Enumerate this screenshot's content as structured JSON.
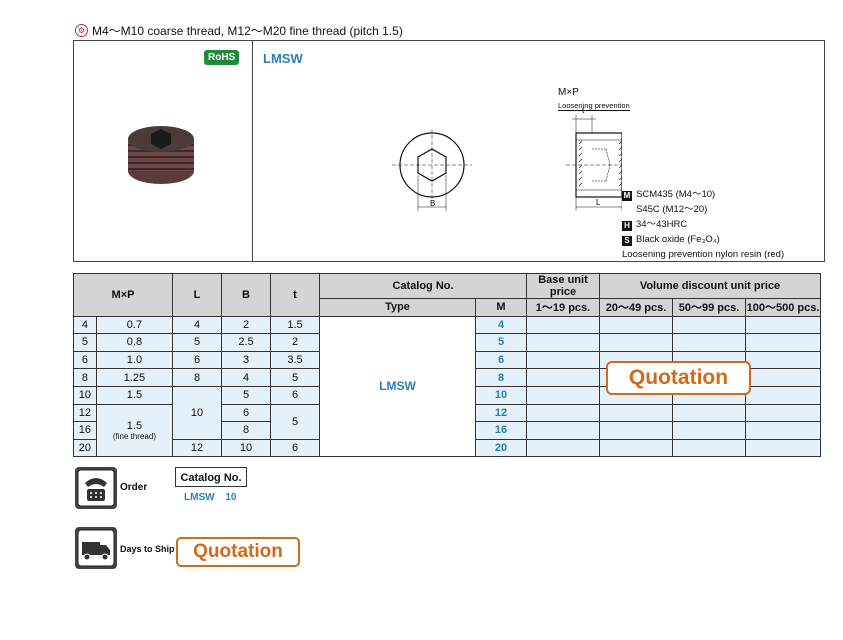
{
  "header": {
    "mark": "⚙",
    "text": "M4～M10 coarse thread, M12～M20 fine thread (pitch 1.5)"
  },
  "product": {
    "rohs": "RoHS",
    "title": "LMSW"
  },
  "drawing": {
    "mxp": "M×P",
    "loosening": "Loosening prevention",
    "t": "t",
    "b": "B",
    "l": "L"
  },
  "spec": [
    {
      "key": "M",
      "text": "SCM435 (M4～10)"
    },
    {
      "key": "",
      "text": "S45C (M12～20)"
    },
    {
      "key": "H",
      "text": "34～43HRC"
    },
    {
      "key": "S",
      "text": "Black oxide (Fe₃O₄)"
    },
    {
      "key": "",
      "text": "Loosening prevention nylon resin (red)"
    }
  ],
  "table": {
    "headers": {
      "mxp": "M×P",
      "l": "L",
      "b": "B",
      "t": "t",
      "catalog": "Catalog No.",
      "type": "Type",
      "m": "M",
      "base": "Base unit price",
      "base_sub": "1～19 pcs.",
      "volume": "Volume discount unit price",
      "v1": "20～49 pcs.",
      "v2": "50～99 pcs.",
      "v3": "100～500 pcs."
    },
    "type_value": "LMSW",
    "rows": [
      {
        "m": "4",
        "p": "0.7",
        "l": "4",
        "b": "2",
        "t": "1.5",
        "mm": "4"
      },
      {
        "m": "5",
        "p": "0.8",
        "l": "5",
        "b": "2.5",
        "t": "2",
        "mm": "5"
      },
      {
        "m": "6",
        "p": "1.0",
        "l": "6",
        "b": "3",
        "t": "3.5",
        "mm": "6"
      },
      {
        "m": "8",
        "p": "1.25",
        "l": "8",
        "b": "4",
        "t": "5",
        "mm": "8"
      },
      {
        "m": "10",
        "p": "1.5",
        "l": "",
        "b": "5",
        "t": "6",
        "mm": "10"
      },
      {
        "m": "12",
        "p": "",
        "l": "10",
        "b": "6",
        "t": "5",
        "mm": "12"
      },
      {
        "m": "16",
        "p": "",
        "l": "",
        "b": "8",
        "t": "",
        "mm": "16"
      },
      {
        "m": "20",
        "p": "",
        "l": "12",
        "b": "10",
        "t": "6",
        "mm": "20"
      }
    ],
    "fine_p": "1.5",
    "fine_note": "(fine thread)",
    "quotation": "Quotation"
  },
  "order": {
    "label": "Order",
    "catalog_header": "Catalog No.",
    "catalog_type": "LMSW",
    "catalog_m": "10"
  },
  "ship": {
    "label": "Days to Ship",
    "value": "Quotation"
  }
}
